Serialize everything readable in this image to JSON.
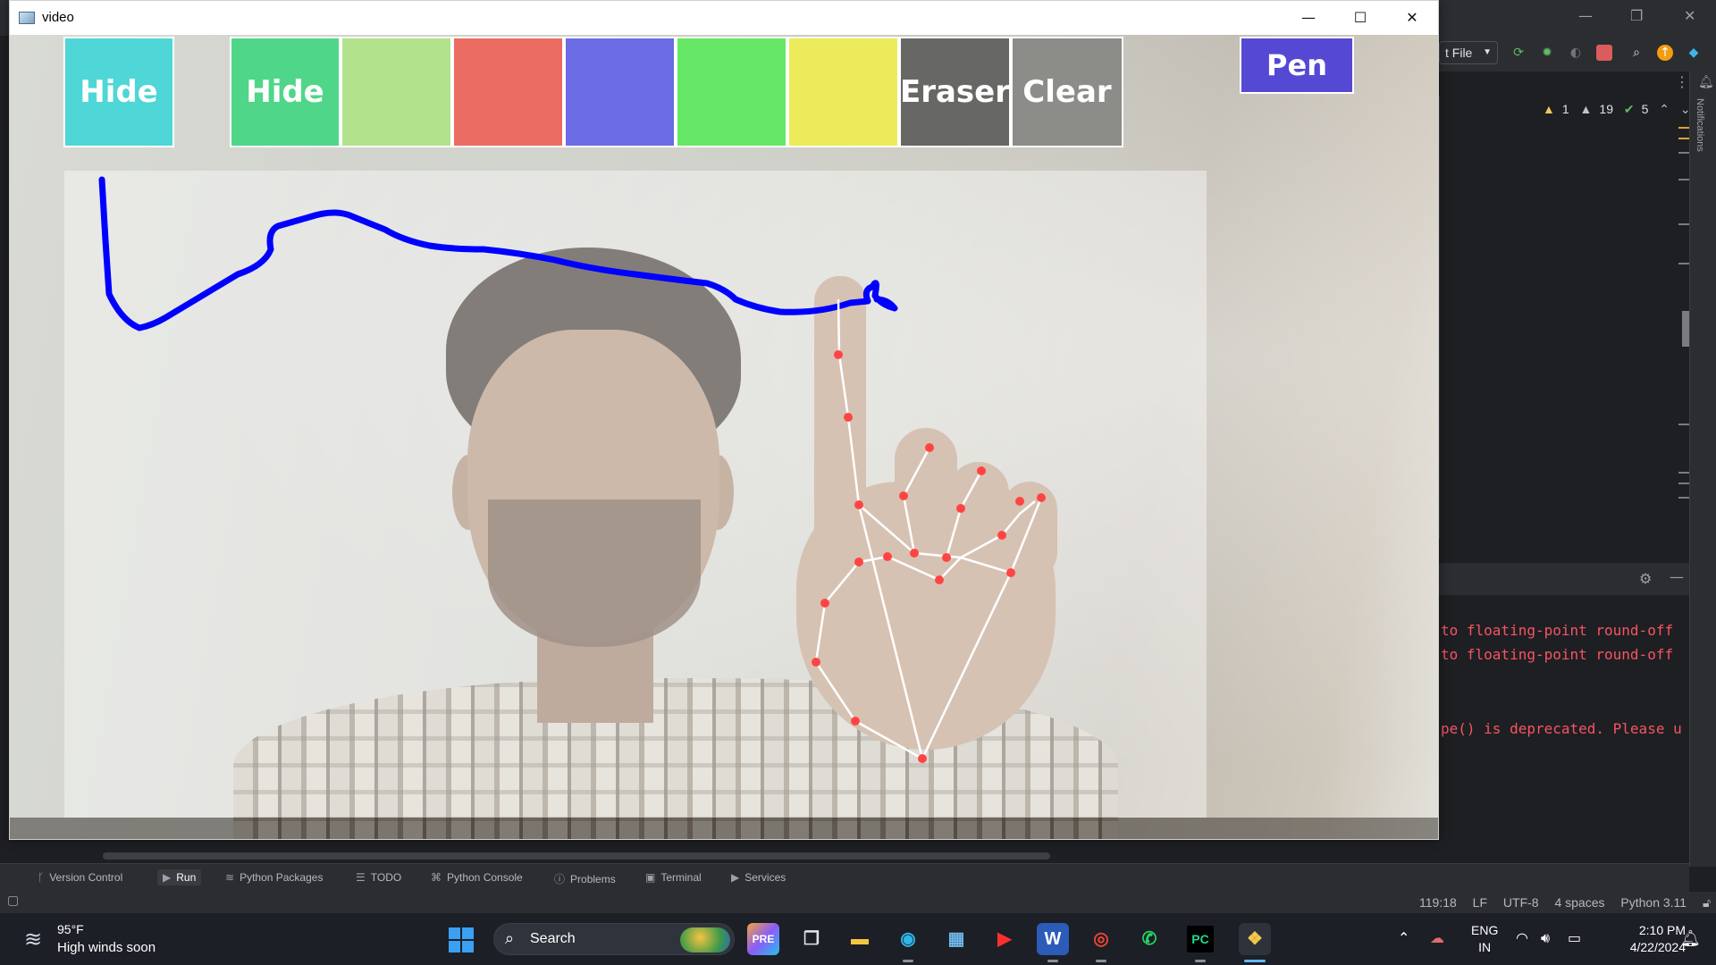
{
  "ide": {
    "run_config_label": "t File",
    "inspections": {
      "warnings": "1",
      "weak_warnings": "19",
      "ok": "5"
    },
    "notifications_label": "Notifications",
    "console_lines": [
      "to floating-point round-off",
      "to floating-point round-off",
      "pe() is deprecated. Please u"
    ],
    "bottom_tools": [
      {
        "label": "Version Control",
        "icon": "branch-icon"
      },
      {
        "label": "Run",
        "icon": "play-icon"
      },
      {
        "label": "Python Packages",
        "icon": "layers-icon"
      },
      {
        "label": "TODO",
        "icon": "list-icon"
      },
      {
        "label": "Python Console",
        "icon": "python-icon"
      },
      {
        "label": "Problems",
        "icon": "info-icon"
      },
      {
        "label": "Terminal",
        "icon": "terminal-icon"
      },
      {
        "label": "Services",
        "icon": "services-icon"
      }
    ],
    "status": {
      "position": "119:18",
      "line_sep": "LF",
      "encoding": "UTF-8",
      "indent": "4 spaces",
      "interpreter": "Python 3.11"
    }
  },
  "video_window": {
    "title": "video",
    "controls": {
      "minimize": "—",
      "maximize": "☐",
      "close": "✕"
    },
    "buttons": {
      "hide_1": "Hide",
      "hide_2": "Hide",
      "eraser": "Eraser",
      "clear": "Clear",
      "pen": "Pen"
    },
    "colors": {
      "hide_1": "#4fd6d6",
      "hide_2": "#4fd689",
      "swatch_light_green": "#b2e38c",
      "swatch_red": "#ea6c63",
      "swatch_blue": "#6c6ce6",
      "swatch_green": "#66e866",
      "swatch_yellow": "#ebeb5c",
      "eraser": "#676765",
      "clear": "#8c8c89",
      "pen": "#5549d4",
      "stroke": "#0000ff",
      "landmark": "#ff4040"
    }
  },
  "taskbar": {
    "weather": {
      "temp": "95°F",
      "desc": "High winds soon"
    },
    "search_label": "Search",
    "language": {
      "lang": "ENG",
      "region": "IN"
    },
    "clock": {
      "time": "2:10 PM",
      "date": "4/22/2024"
    }
  }
}
